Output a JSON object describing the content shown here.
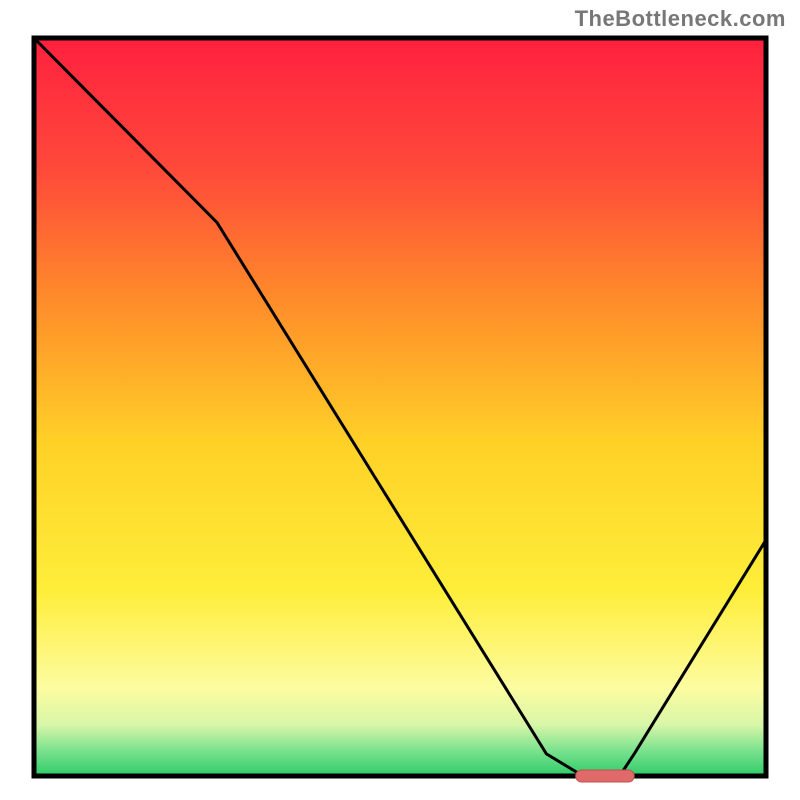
{
  "watermark": "TheBottleneck.com",
  "chart_data": {
    "type": "line",
    "title": "",
    "xlabel": "",
    "ylabel": "",
    "xlim": [
      0,
      100
    ],
    "ylim": [
      0,
      100
    ],
    "series": [
      {
        "name": "bottleneck-curve",
        "x": [
          0,
          5,
          25,
          70,
          75,
          80,
          82,
          100
        ],
        "values": [
          100,
          95,
          75,
          3,
          0,
          0,
          3,
          32
        ]
      }
    ],
    "marker": {
      "x_start": 74,
      "x_end": 82,
      "y": 0
    },
    "gradient_stops": [
      {
        "offset": 0.0,
        "color": "#ff203f"
      },
      {
        "offset": 0.18,
        "color": "#ff4a3a"
      },
      {
        "offset": 0.35,
        "color": "#ff8a2a"
      },
      {
        "offset": 0.55,
        "color": "#ffd127"
      },
      {
        "offset": 0.75,
        "color": "#feee3a"
      },
      {
        "offset": 0.88,
        "color": "#fdfca0"
      },
      {
        "offset": 0.93,
        "color": "#d9f6a8"
      },
      {
        "offset": 0.965,
        "color": "#7ce28f"
      },
      {
        "offset": 1.0,
        "color": "#2ecb6a"
      }
    ],
    "colors": {
      "frame": "#000000",
      "line": "#000000",
      "marker_fill": "#e06a6a",
      "marker_stroke": "#c24f4f"
    }
  }
}
